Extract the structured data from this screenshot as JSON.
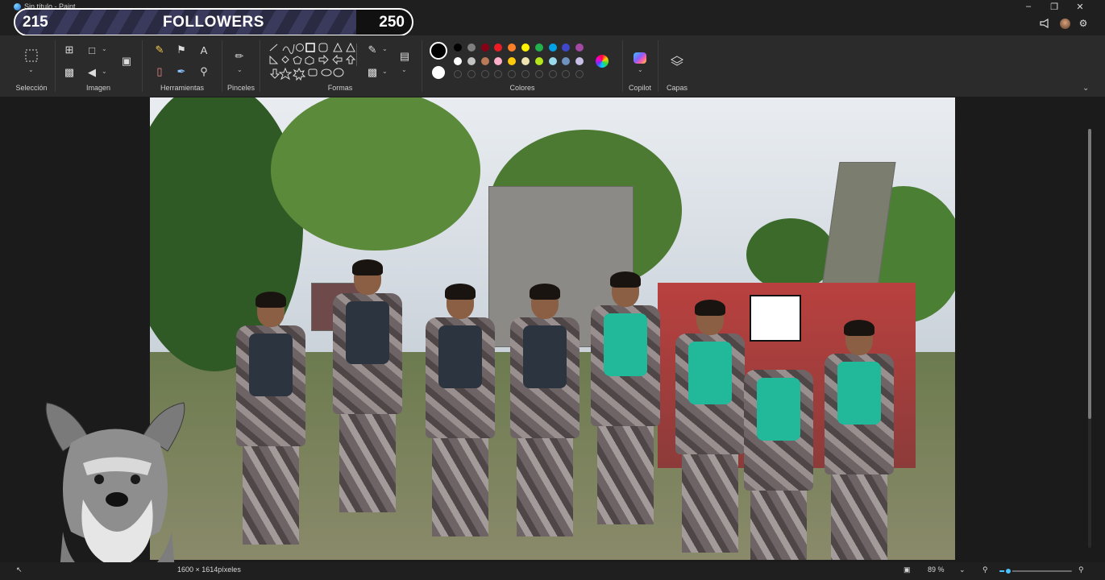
{
  "app": {
    "title": "Sin título - Paint"
  },
  "window_controls": [
    "minimize",
    "maximize",
    "close"
  ],
  "overlay": {
    "current": "215",
    "label": "FOLLOWERS",
    "goal": "250",
    "progress_fraction": 0.86
  },
  "toolbar_right_icons": [
    "share-icon",
    "avatar",
    "settings-icon"
  ],
  "ribbon": {
    "groups": {
      "selection": "Selección",
      "image": "Imagen",
      "tools": "Herramientas",
      "brushes": "Pinceles",
      "shapes": "Formas",
      "colors": "Colores",
      "copilot": "Copilot",
      "layers": "Capas"
    },
    "color1": "#000000",
    "color2": "#ffffff",
    "palette_row1": [
      "#000000",
      "#7f7f7f",
      "#880015",
      "#ed1c24",
      "#ff7f27",
      "#fff200",
      "#22b14c",
      "#00a2e8",
      "#3f48cc",
      "#a349a4"
    ],
    "palette_row2": [
      "#ffffff",
      "#c3c3c3",
      "#b97a57",
      "#ffaec9",
      "#ffc90e",
      "#efe4b0",
      "#b5e61d",
      "#99d9ea",
      "#7092be",
      "#c8bfe7"
    ]
  },
  "status": {
    "dimensions": "1600 × 1614píxeles",
    "zoom": "89 %",
    "zoom_fraction": 0.12
  },
  "accent": "#4cc2ff"
}
